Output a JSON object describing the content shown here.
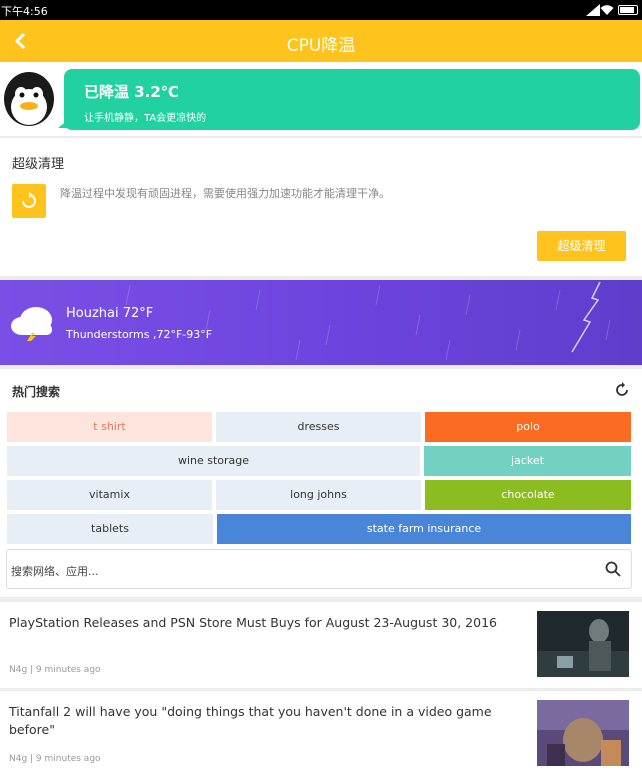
{
  "status_bar": {
    "time": "下午4:56"
  },
  "app_bar": {
    "back_icon": "chevron-left-icon",
    "title": "CPU降温"
  },
  "cooling": {
    "headline": "已降温 3.2℃",
    "subtext": "让手机静静，TA会更凉快的"
  },
  "super_clean": {
    "title": "超级清理",
    "description": "降温过程中发现有顽固进程，需要使用强力加速功能才能清理干净。",
    "button_label": "超级清理",
    "icon": "refresh-icon"
  },
  "weather": {
    "location_temp": "Houzhai 72°F",
    "condition": "Thunderstorms ,72°F-93°F",
    "icon": "thunderstorm-cloud-icon"
  },
  "hot_search": {
    "title": "热门搜索",
    "tags": [
      {
        "label": "t shirt",
        "bg": "#fde4dc",
        "fg": "#e07a5a"
      },
      {
        "label": "dresses",
        "bg": "#e8eef6",
        "fg": "#333333"
      },
      {
        "label": "polo",
        "bg": "#fd6a22",
        "fg": "#ffffff"
      },
      {
        "label": "wine storage",
        "bg": "#e8eef6",
        "fg": "#333333"
      },
      {
        "label": "jacket",
        "bg": "#73d1c1",
        "fg": "#ffffff"
      },
      {
        "label": "vitamix",
        "bg": "#e8eef6",
        "fg": "#333333"
      },
      {
        "label": "long johns",
        "bg": "#e8eef6",
        "fg": "#333333"
      },
      {
        "label": "chocolate",
        "bg": "#8bbd20",
        "fg": "#ffffff"
      },
      {
        "label": "tablets",
        "bg": "#e8eef6",
        "fg": "#333333"
      },
      {
        "label": "state farm insurance",
        "bg": "#4a86d8",
        "fg": "#ffffff"
      }
    ],
    "search_placeholder": "搜索网络、应用..."
  },
  "news": [
    {
      "title": "PlayStation Releases and PSN Store Must Buys for August 23-August 30, 2016",
      "meta": "N4g | 9 minutes ago"
    },
    {
      "title": "Titanfall 2 will have you \"doing things that you haven't done in a video game before\"",
      "meta": "N4g | 9 minutes ago"
    }
  ]
}
